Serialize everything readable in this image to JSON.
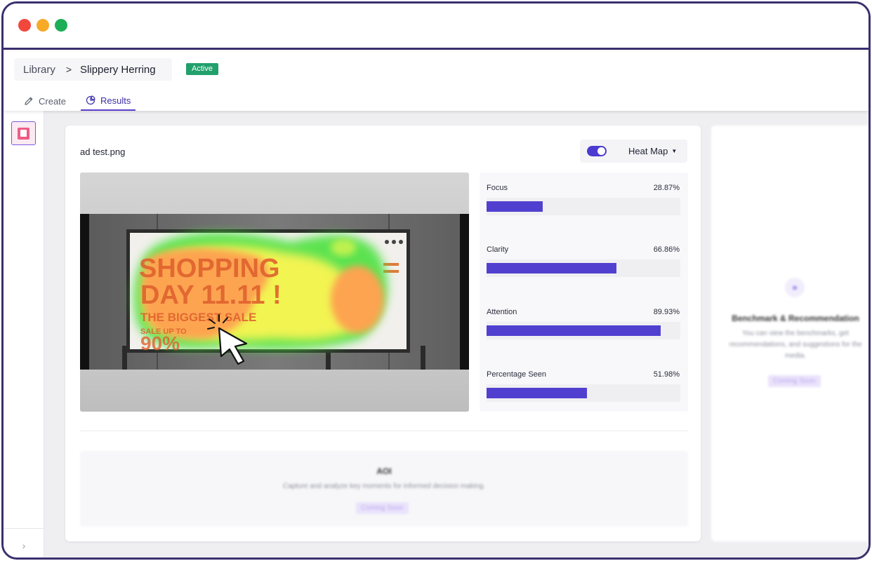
{
  "breadcrumb": {
    "library": "Library",
    "separator": ">",
    "current": "Slippery Herring"
  },
  "status_badge": "Active",
  "tabs": [
    {
      "label": "Create",
      "icon": "pencil-icon",
      "active": false
    },
    {
      "label": "Results",
      "icon": "pie-chart-icon",
      "active": true
    }
  ],
  "file": {
    "name": "ad test.png"
  },
  "view": {
    "heatmap_enabled": true,
    "selected": "Heat Map"
  },
  "ad_image": {
    "line1": "SHOPPING",
    "line2": "DAY 11.11 !",
    "line3": "THE BIGGEST SALE",
    "line4": "SALE UP TO",
    "line5": "90%"
  },
  "metrics": [
    {
      "label": "Focus",
      "value": "28.87%",
      "fraction": 0.2887
    },
    {
      "label": "Clarity",
      "value": "66.86%",
      "fraction": 0.6686
    },
    {
      "label": "Attention",
      "value": "89.93%",
      "fraction": 0.8993
    },
    {
      "label": "Percentage Seen",
      "value": "51.98%",
      "fraction": 0.5198
    }
  ],
  "aoi": {
    "title": "AOI",
    "description": "Capture and analyze key moments for informed decision making.",
    "coming_soon": "Coming Soon"
  },
  "benchmark": {
    "title": "Benchmark & Recommendation",
    "description": "You can view the benchmarks, get recommendations, and suggestions for the media.",
    "coming_soon": "Coming Soon"
  },
  "colors": {
    "accent": "#5140d0",
    "badge": "#22a06b",
    "frame": "#3b2f6e"
  }
}
